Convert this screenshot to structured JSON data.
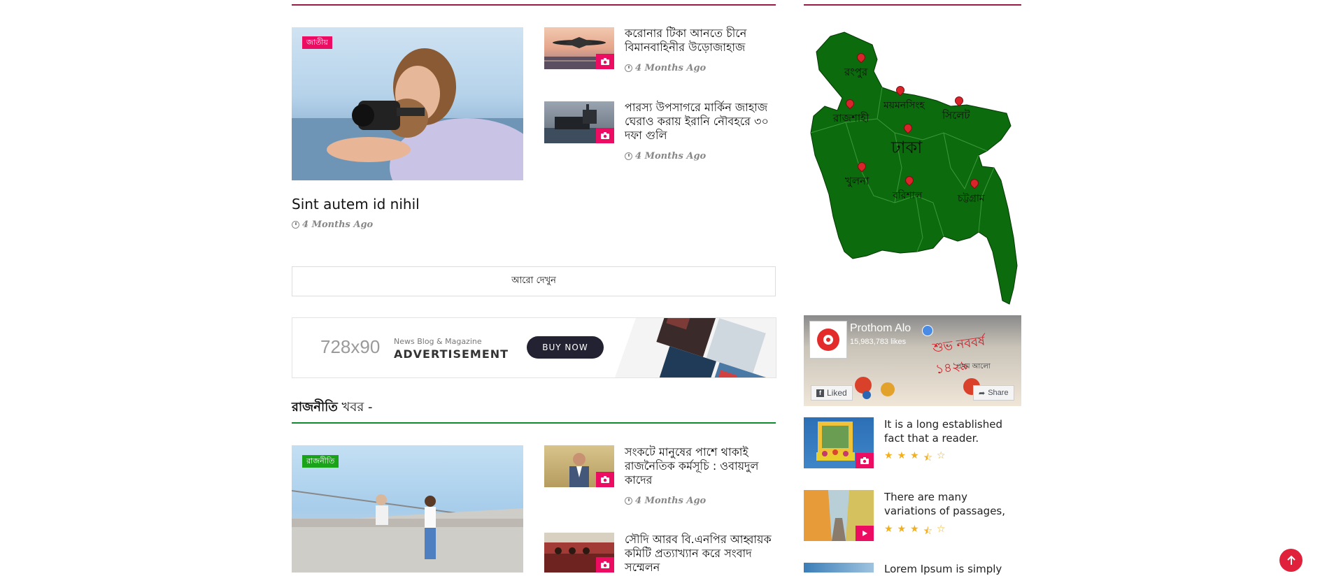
{
  "colors": {
    "accent_red": "#9b1b48",
    "badge_pink": "#ec0c62",
    "badge_green": "#18a318",
    "map_green": "#0c6b0c",
    "section_rule_green": "#0f8a2f",
    "scroll_button": "#e0213b"
  },
  "national": {
    "badge": "জাতীয়",
    "lead": {
      "title": "Sint autem id nihil",
      "time": "4 Months Ago"
    },
    "side": [
      {
        "title": "করোনার টিকা আনতে চীনে বিমানবাহিনীর উড়োজাহাজ",
        "time": "4 Months Ago",
        "icon": "camera-icon"
      },
      {
        "title": "পারস্য উপসাগরে মার্কিন জাহাজ ঘেরাও করায় ইরানি নৌবহরে ৩০ দফা গুলি",
        "time": "4 Months Ago",
        "icon": "camera-icon"
      }
    ],
    "more_button": "আরো দেখুন"
  },
  "ad": {
    "size": "728x90",
    "small": "News Blog & Magazine",
    "big": "ADVERTISEMENT",
    "cta": "BUY NOW"
  },
  "politics": {
    "heading_bold": "রাজনীতি",
    "heading_rest": "খবর -",
    "badge": "রাজনীতি",
    "side": [
      {
        "title": "সংকটে মানুষের পাশে থাকাই রাজনৈতিক কর্মসূচি : ওবায়দুল কাদের",
        "time": "4 Months Ago",
        "icon": "camera-icon"
      },
      {
        "title": "সৌদি আরব বি.এনপির আহ্বায়ক কমিটি প্রত্যাখ্যান করে সংবাদ সম্মেলন",
        "icon": "camera-icon"
      }
    ]
  },
  "map": {
    "divisions": [
      "রংপুর",
      "ময়মনসিংহ",
      "সিলেট",
      "রাজশাহী",
      "ঢাকা",
      "খুলনা",
      "বরিশাল",
      "চট্টগ্রাম"
    ]
  },
  "facebook": {
    "page_name": "Prothom Alo",
    "likes": "15,983,783 likes",
    "liked_button": "Liked",
    "share_button": "Share",
    "banner_text": "শুভ নববর্ষ ১৪২৯",
    "brand_text": "প্রথম আলো"
  },
  "widget": {
    "items": [
      {
        "title": "It is a long established fact that a reader.",
        "rating": 3.5,
        "icon": "camera-icon"
      },
      {
        "title": "There are many variations of passages,",
        "rating": 3.5,
        "icon": "play-icon"
      },
      {
        "title": "Lorem Ipsum is simply",
        "icon": ""
      }
    ]
  }
}
